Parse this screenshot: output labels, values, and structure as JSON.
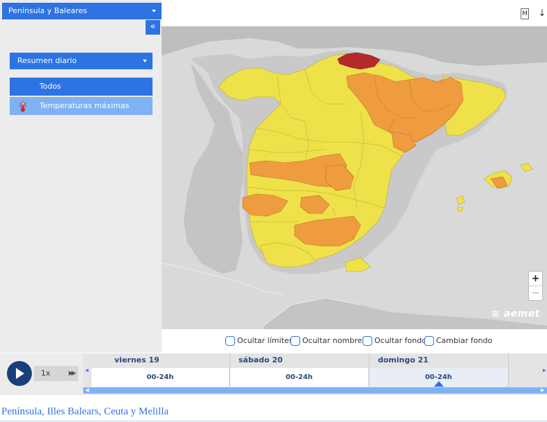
{
  "region_select": {
    "label": "Península y Baleares"
  },
  "collapse_button": {
    "label": "«"
  },
  "summary_select": {
    "label": "Resumen diario"
  },
  "layers": [
    {
      "label": "Todos",
      "selected": true
    },
    {
      "label": "Temperaturas máximas",
      "icon": "thermometer-icon",
      "selected": false
    }
  ],
  "toolbar": {
    "m_label": "M",
    "download_label": "↓"
  },
  "map": {
    "legend_colors": {
      "no_warning": "#c8c8c8",
      "yellow": "#f0e148",
      "orange": "#ef9e41",
      "red": "#b72a2a",
      "sea": "#d9d9d9"
    },
    "zoom_in": "+",
    "zoom_out": "−",
    "logo_text": "aemet"
  },
  "options": [
    {
      "label": "Ocultar límites"
    },
    {
      "label": "Ocultar nombres"
    },
    {
      "label": "Ocultar fondo"
    },
    {
      "label": "Cambiar fondo"
    }
  ],
  "player": {
    "speed": "1x",
    "fast_forward": "▶▶"
  },
  "timeline": {
    "days": [
      {
        "name": "viernes 19",
        "period": "00-24h"
      },
      {
        "name": "sábado 20",
        "period": "00-24h"
      },
      {
        "name": "domingo 21",
        "period": "00-24h",
        "active": true
      }
    ]
  },
  "footer": {
    "title": "Península, Illes Balears, Ceuta y Melilla"
  },
  "colors": {
    "accent": "#2d73e3",
    "accent_light": "#7fb1f5",
    "play_button": "#173f7a"
  }
}
